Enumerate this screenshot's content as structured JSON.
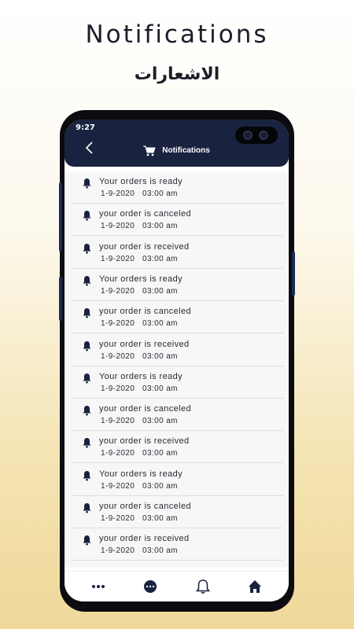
{
  "promo": {
    "title": "Notifications",
    "subtitle": "الاشعارات"
  },
  "status_bar": {
    "time": "9:27"
  },
  "appbar": {
    "title": "Notifications",
    "back_icon": "chevron-left-icon",
    "title_icon": "cart-icon"
  },
  "notifications": [
    {
      "text": "Your orders is ready",
      "date": "1-9-2020",
      "time": "03:00 am"
    },
    {
      "text": "your order is canceled",
      "date": "1-9-2020",
      "time": "03:00 am"
    },
    {
      "text": "your order is received",
      "date": "1-9-2020",
      "time": "03:00 am"
    },
    {
      "text": "Your orders is ready",
      "date": "1-9-2020",
      "time": "03:00 am"
    },
    {
      "text": "your order is canceled",
      "date": "1-9-2020",
      "time": "03:00 am"
    },
    {
      "text": "your order is received",
      "date": "1-9-2020",
      "time": "03:00 am"
    },
    {
      "text": "Your orders is ready",
      "date": "1-9-2020",
      "time": "03:00 am"
    },
    {
      "text": "your order is canceled",
      "date": "1-9-2020",
      "time": "03:00 am"
    },
    {
      "text": "your order is received",
      "date": "1-9-2020",
      "time": "03:00 am"
    },
    {
      "text": "Your orders is ready",
      "date": "1-9-2020",
      "time": "03:00 am"
    },
    {
      "text": "your order is canceled",
      "date": "1-9-2020",
      "time": "03:00 am"
    },
    {
      "text": "your order is received",
      "date": "1-9-2020",
      "time": "03:00 am"
    }
  ],
  "bottom_nav": {
    "items": [
      "more-icon",
      "chat-icon",
      "bell-icon",
      "home-icon"
    ]
  },
  "colors": {
    "appbar": "#192340",
    "icon": "#192340",
    "text": "#2a2a35",
    "divider": "#dcdcea",
    "gold": "#efd89a"
  }
}
